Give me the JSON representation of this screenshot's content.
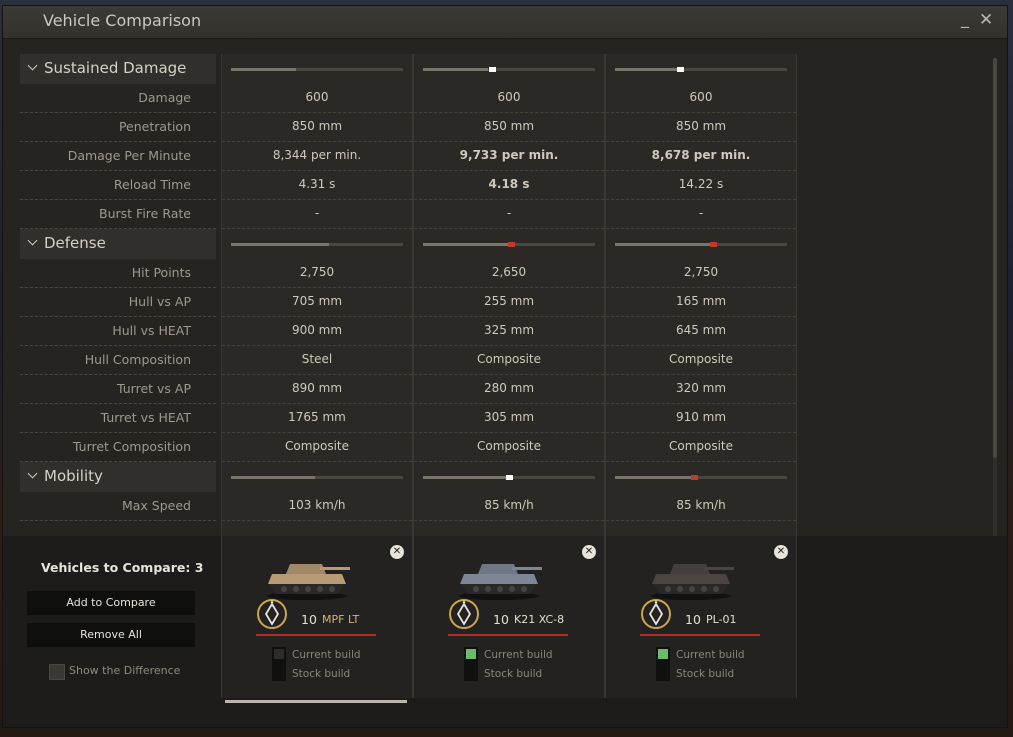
{
  "window": {
    "title": "Vehicle Comparison",
    "minimize": "_",
    "close": "✕"
  },
  "sections": [
    {
      "name": "Sustained Damage",
      "bars": [
        {
          "fill_fraction": 0.38,
          "mark": null
        },
        {
          "fill_fraction": 0.38,
          "mark": {
            "fraction": 0.4,
            "color": "#ffffff"
          }
        },
        {
          "fill_fraction": 0.38,
          "mark": {
            "fraction": 0.38,
            "color": "#ffffff"
          }
        }
      ],
      "rows": [
        {
          "label": "Damage",
          "values": [
            {
              "text": "600",
              "tone": "normal"
            },
            {
              "text": "600",
              "tone": "normal"
            },
            {
              "text": "600",
              "tone": "normal"
            }
          ]
        },
        {
          "label": "Penetration",
          "values": [
            {
              "text": "850 mm",
              "tone": "normal"
            },
            {
              "text": "850 mm",
              "tone": "normal"
            },
            {
              "text": "850 mm",
              "tone": "normal"
            }
          ]
        },
        {
          "label": "Damage Per Minute",
          "values": [
            {
              "text": "8,344 per min.",
              "tone": "normal"
            },
            {
              "text": "9,733 per min.",
              "tone": "good"
            },
            {
              "text": "8,678 per min.",
              "tone": "good"
            }
          ]
        },
        {
          "label": "Reload Time",
          "values": [
            {
              "text": "4.31 s",
              "tone": "normal"
            },
            {
              "text": "4.18 s",
              "tone": "good"
            },
            {
              "text": "14.22 s",
              "tone": "bad"
            }
          ]
        },
        {
          "label": "Burst Fire Rate",
          "values": [
            {
              "text": "-",
              "tone": "normal"
            },
            {
              "text": "-",
              "tone": "normal"
            },
            {
              "text": "-",
              "tone": "normal"
            }
          ]
        }
      ]
    },
    {
      "name": "Defense",
      "bars": [
        {
          "fill_fraction": 0.57,
          "mark": null
        },
        {
          "fill_fraction": 0.51,
          "mark": {
            "fraction": 0.51,
            "color": "#c0392b"
          }
        },
        {
          "fill_fraction": 0.57,
          "mark": {
            "fraction": 0.57,
            "color": "#c0392b"
          }
        }
      ],
      "rows": [
        {
          "label": "Hit Points",
          "values": [
            {
              "text": "2,750",
              "tone": "normal"
            },
            {
              "text": "2,650",
              "tone": "bad"
            },
            {
              "text": "2,750",
              "tone": "normal"
            }
          ]
        },
        {
          "label": "Hull vs AP",
          "values": [
            {
              "text": "705 mm",
              "tone": "normal"
            },
            {
              "text": "255 mm",
              "tone": "bad"
            },
            {
              "text": "165 mm",
              "tone": "bad"
            }
          ]
        },
        {
          "label": "Hull vs HEAT",
          "values": [
            {
              "text": "900 mm",
              "tone": "normal"
            },
            {
              "text": "325 mm",
              "tone": "bad"
            },
            {
              "text": "645 mm",
              "tone": "bad"
            }
          ]
        },
        {
          "label": "Hull Composition",
          "values": [
            {
              "text": "Steel",
              "tone": "normal"
            },
            {
              "text": "Composite",
              "tone": "normal"
            },
            {
              "text": "Composite",
              "tone": "normal"
            }
          ]
        },
        {
          "label": "Turret vs AP",
          "values": [
            {
              "text": "890 mm",
              "tone": "normal"
            },
            {
              "text": "280 mm",
              "tone": "bad"
            },
            {
              "text": "320 mm",
              "tone": "bad"
            }
          ]
        },
        {
          "label": "Turret vs HEAT",
          "values": [
            {
              "text": "1765 mm",
              "tone": "normal"
            },
            {
              "text": "305 mm",
              "tone": "bad"
            },
            {
              "text": "910 mm",
              "tone": "bad"
            }
          ]
        },
        {
          "label": "Turret Composition",
          "values": [
            {
              "text": "Composite",
              "tone": "normal"
            },
            {
              "text": "Composite",
              "tone": "normal"
            },
            {
              "text": "Composite",
              "tone": "normal"
            }
          ]
        }
      ]
    },
    {
      "name": "Mobility",
      "bars": [
        {
          "fill_fraction": 0.49,
          "mark": null
        },
        {
          "fill_fraction": 0.5,
          "mark": {
            "fraction": 0.5,
            "color": "#ffffff"
          }
        },
        {
          "fill_fraction": 0.46,
          "mark": {
            "fraction": 0.46,
            "color": "#c0392b"
          }
        }
      ],
      "rows": [
        {
          "label": "Max Speed",
          "values": [
            {
              "text": "103 km/h",
              "tone": "normal"
            },
            {
              "text": "85 km/h",
              "tone": "bad"
            },
            {
              "text": "85 km/h",
              "tone": "bad"
            }
          ]
        }
      ]
    }
  ],
  "compare_panel": {
    "title": "Vehicles to Compare: 3",
    "add_button": "Add to Compare",
    "remove_button": "Remove All",
    "show_difference": "Show the Difference",
    "show_difference_checked": false
  },
  "vehicles": [
    {
      "tier": "10",
      "name": "MPF LT",
      "name_color": "gold",
      "current_build_selected": false,
      "current_build_label": "Current build",
      "stock_build_label": "Stock build",
      "tank_color": "#b79b76",
      "remove": "✕"
    },
    {
      "tier": "10",
      "name": "K21 XC-8",
      "name_color": "white",
      "current_build_selected": true,
      "current_build_label": "Current build",
      "stock_build_label": "Stock build",
      "tank_color": "#7d8596",
      "remove": "✕"
    },
    {
      "tier": "10",
      "name": "PL-01",
      "name_color": "white",
      "current_build_selected": true,
      "current_build_label": "Current build",
      "stock_build_label": "Stock build",
      "tank_color": "#4a4442",
      "remove": "✕"
    }
  ],
  "colors": {
    "good": "#f2efe8",
    "bad": "#e23b2e",
    "normal": "#cfc9bd",
    "accent_underline": "#b62a24",
    "checkbox_on": "#6dbb6a"
  }
}
